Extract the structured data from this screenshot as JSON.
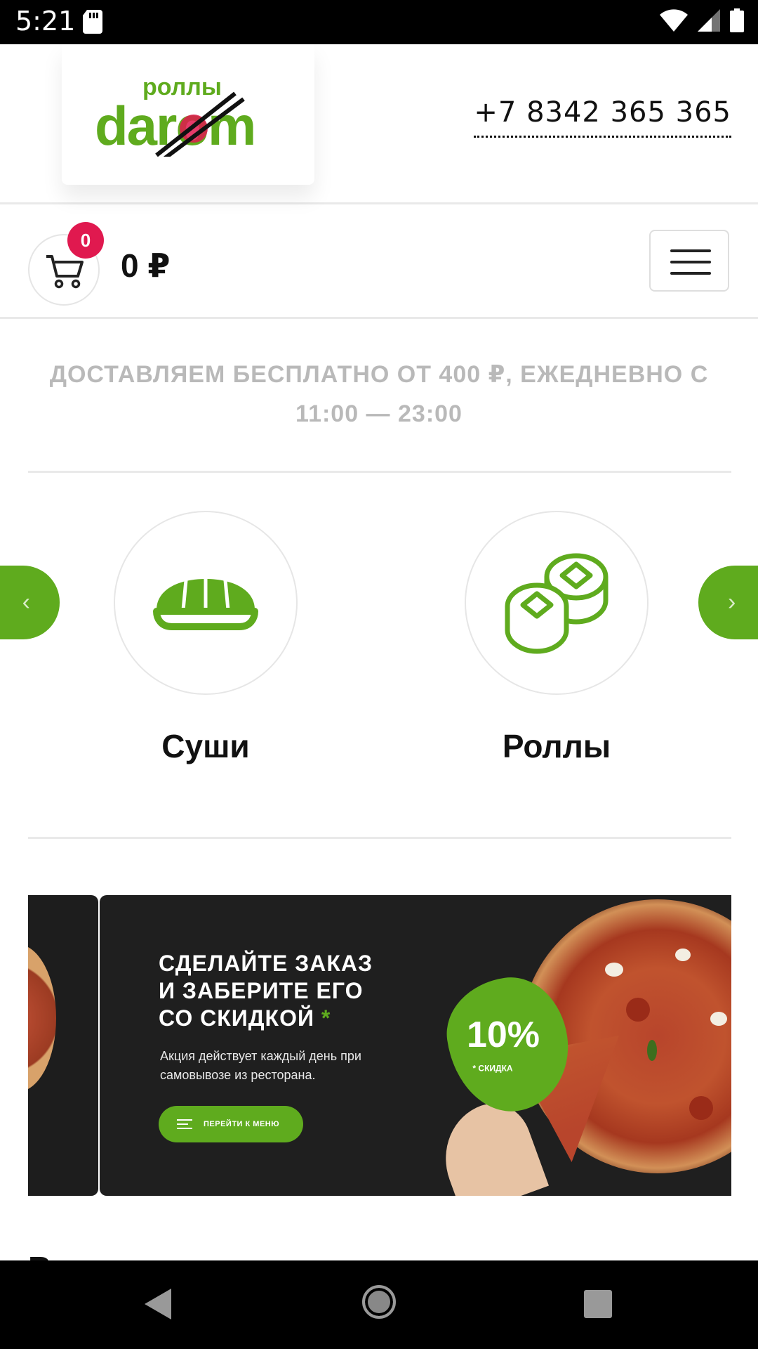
{
  "status_bar": {
    "time": "5:21"
  },
  "header": {
    "logo_small": "роллы",
    "logo_main": "darom",
    "phone": "+7 8342 365 365"
  },
  "cart": {
    "count": "0",
    "total": "0 ₽"
  },
  "delivery": {
    "text": "ДОСТАВЛЯЕМ БЕСПЛАТНО ОТ 400 ₽, ЕЖЕДНЕВНО С 11:00 — 23:00"
  },
  "categories": [
    {
      "label": "Суши",
      "icon": "sushi-icon"
    },
    {
      "label": "Роллы",
      "icon": "rolls-icon"
    }
  ],
  "carousel": {
    "prev": "‹",
    "next": "›"
  },
  "banner": {
    "title_line1": "СДЕЛАЙТЕ ЗАКАЗ",
    "title_line2": "И ЗАБЕРИТЕ ЕГО",
    "title_line3": "СО СКИДКОЙ",
    "title_star": "*",
    "description": "Акция действует каждый день при самовывозе из ресторана.",
    "cta": "ПЕРЕЙТИ К МЕНЮ",
    "discount": "10%",
    "discount_note": "* СКИДКА"
  },
  "next_section_partial": "В",
  "colors": {
    "accent_green": "#5fab1e",
    "badge_red": "#e0194f",
    "muted_text": "#b9b9b9"
  }
}
